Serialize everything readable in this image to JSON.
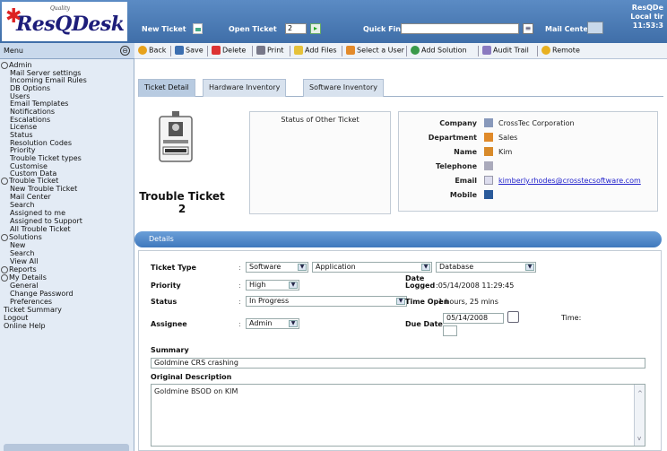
{
  "logo": {
    "small": "Quality",
    "big": "ResQDesk"
  },
  "topbar": {
    "new_ticket": "New Ticket",
    "open_ticket": "Open Ticket",
    "open_ticket_value": "2",
    "quick_find": "Quick Find",
    "quick_find_value": "",
    "mail_center": "Mail Center",
    "right_line1": "ResQDe",
    "right_line2": "Local tir",
    "right_line3": "11:53:3"
  },
  "menu": {
    "label": "Menu"
  },
  "toolbar": {
    "back": "Back",
    "save": "Save",
    "delete": "Delete",
    "print": "Print",
    "add_files": "Add Files",
    "select_user": "Select a User",
    "add_solution": "Add Solution",
    "audit_trail": "Audit Trail",
    "remote": "Remote"
  },
  "sidebar": {
    "admin": "Admin",
    "admin_items": [
      "Mail Server settings",
      "Incoming Email Rules",
      "DB Options",
      "Users",
      "Email Templates",
      "Notifications",
      "Escalations",
      "License",
      "Status",
      "Resolution Codes",
      "Priority",
      "Trouble Ticket types",
      "Customise",
      "Custom Data"
    ],
    "trouble_ticket": "Trouble Ticket",
    "tt_items": [
      "New Trouble Ticket",
      "Mail Center",
      "Search",
      "Assigned to me",
      "Assigned to Support",
      "All Trouble Ticket"
    ],
    "solutions": "Solutions",
    "sol_items": [
      "New",
      "Search",
      "View All"
    ],
    "reports": "Reports",
    "my_details": "My Details",
    "md_items": [
      "General",
      "Change Password",
      "Preferences"
    ],
    "ticket_summary": "Ticket Summary",
    "logout": "Logout",
    "online_help": "Online Help"
  },
  "tabs": [
    "Ticket Detail",
    "Hardware Inventory",
    "Software Inventory"
  ],
  "ticket": {
    "title": "Trouble Ticket",
    "number": "2"
  },
  "status_box": {
    "title": "Status of Other Ticket"
  },
  "contact": {
    "company_label": "Company",
    "company": "CrossTec Corporation",
    "department_label": "Department",
    "department": "Sales",
    "name_label": "Name",
    "name": "Kim",
    "telephone_label": "Telephone",
    "telephone": "",
    "email_label": "Email",
    "email": "kimberly.rhodes@crosstecsoftware.com",
    "mobile_label": "Mobile",
    "mobile": ""
  },
  "details": {
    "header": "Details",
    "ticket_type_label": "Ticket Type",
    "ticket_type_1": "Software",
    "ticket_type_2": "Application",
    "ticket_type_3": "Database",
    "priority_label": "Priority",
    "priority": "High",
    "date_logged_label": "Date Logged",
    "date_logged": "05/14/2008 11:29:45",
    "status_label": "Status",
    "status": "In Progress",
    "time_open_label": "Time Open",
    "time_open": "1 hours, 25 mins",
    "assignee_label": "Assignee",
    "assignee": "Admin",
    "due_date_label": "Due Date",
    "due_date": "05/14/2008",
    "time_label": "Time:",
    "time_value": "",
    "summary_label": "Summary",
    "summary": "Goldmine CRS crashing",
    "orig_desc_label": "Original Description",
    "orig_desc": "Goldmine BSOD on KIM"
  }
}
